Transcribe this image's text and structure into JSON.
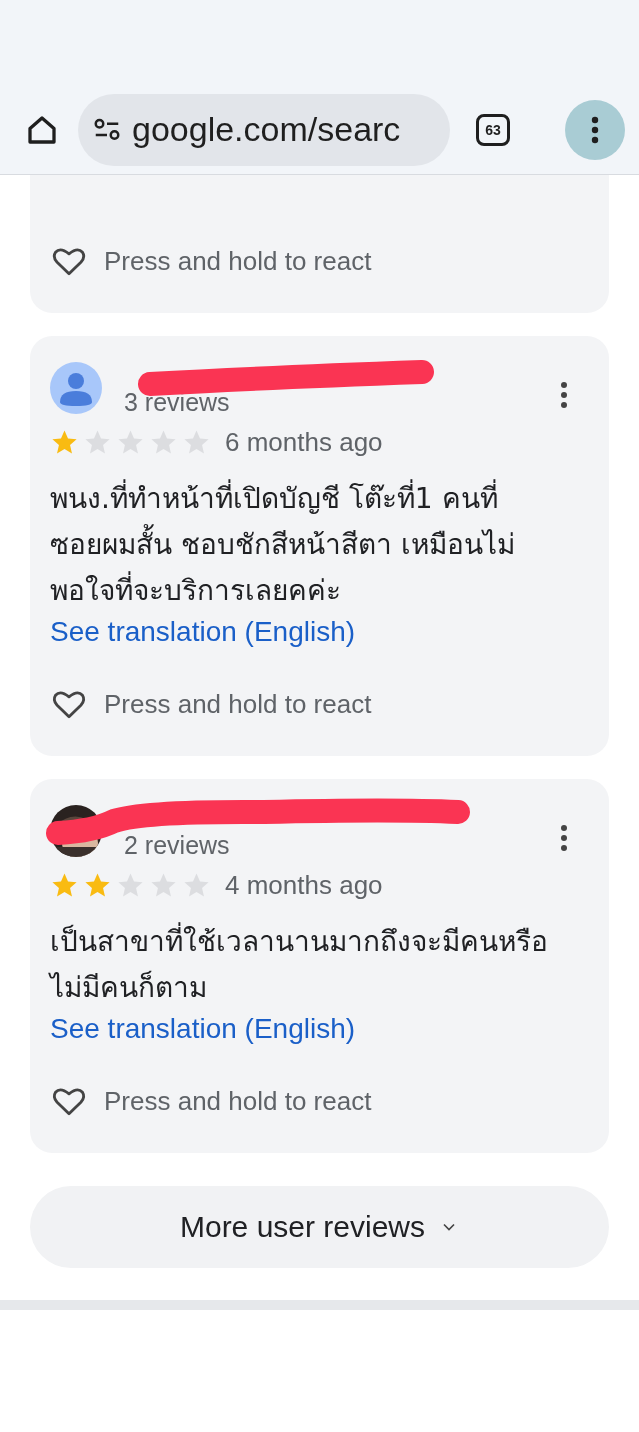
{
  "toolbar": {
    "url": "google.com/searc",
    "tab_count": "63"
  },
  "reviews": [
    {
      "react_label": "Press and hold to react"
    },
    {
      "avatar": {
        "kind": "silhouette"
      },
      "review_count": "3 reviews",
      "stars": 1,
      "time": "6 months ago",
      "text": "พนง.ที่ทำหน้าที่เปิดบัญชี โต๊ะที่1 คนที่ซอยผมสั้น ชอบชักสีหน้าสีตา เหมือนไม่พอใจที่จะบริการเลยคค่ะ",
      "translate_link": "See translation (English)",
      "react_label": "Press and hold to react"
    },
    {
      "review_count": "2 reviews",
      "stars": 2,
      "time": "4 months ago",
      "text": "เป็นสาขาที่ใช้เวลานานมากถึงจะมีคนหรือไม่มีคนก็ตาม",
      "translate_link": "See translation (English)",
      "react_label": "Press and hold to react"
    }
  ],
  "more_button": {
    "label": "More user reviews"
  }
}
